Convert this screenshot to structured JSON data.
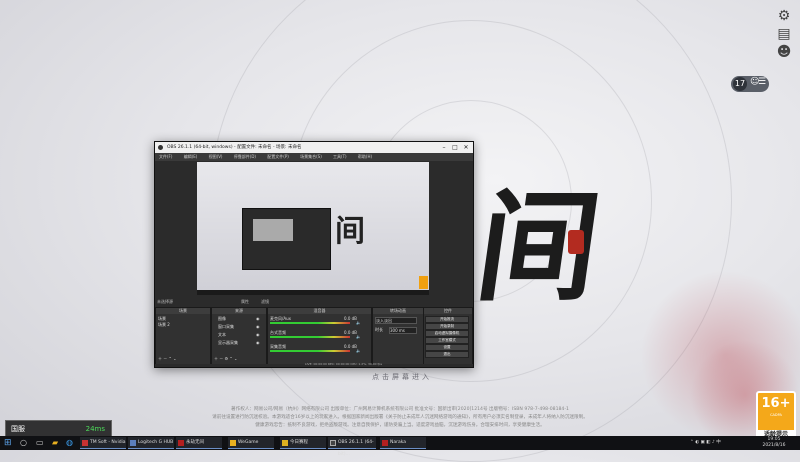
{
  "right_icons": [
    {
      "icon": "gear-icon"
    },
    {
      "icon": "announcement-icon"
    },
    {
      "icon": "account-icon"
    }
  ],
  "player_chip": {
    "number": "17"
  },
  "obs": {
    "title": "OBS 26.1.1 (64-bit, windows) - 配置文件: 未命名 - 场景: 未命名",
    "menu": [
      "文件(F)",
      "编辑(E)",
      "视图(V)",
      "停靠部件(D)",
      "配置文件(P)",
      "场景集合(S)",
      "工具(T)",
      "帮助(H)"
    ],
    "preview_label": "未选择源",
    "props_label": "属性",
    "filters_label": "滤镜",
    "docks": {
      "scenes": {
        "header": "场景",
        "items": [
          "场景",
          "场景 2"
        ]
      },
      "sources": {
        "header": "来源",
        "items": [
          "图像",
          "窗口采集",
          "文本",
          "显示器采集"
        ]
      },
      "mixer": {
        "header": "混音器",
        "items": [
          "麦克风/Aux",
          "台式音频",
          "采集音频"
        ],
        "levels": [
          "0.0 dB",
          "0.0 dB",
          "0.0 dB"
        ]
      },
      "transitions": {
        "header": "转场动画",
        "items": [
          "淡入淡出",
          "时长"
        ],
        "duration": "300 ms"
      },
      "controls": {
        "header": "控件",
        "buttons": [
          "开始推流",
          "开始录制",
          "启动虚拟摄像机",
          "工作室模式",
          "设置",
          "退出"
        ]
      }
    },
    "status": "LIVE: 00:00:00  REC: 00:00:00  CPU: 1.2%, 30.00 fps"
  },
  "enter_game": "点击屏幕进入",
  "footer_lines": [
    "著作权人：网易公司/网易（杭州）网络有限公司  出版单位：广州网易计算机系统有限公司  批准文号：国新出审[2020]1214号  出版物号：ISBN 978-7-498-08184-1",
    "请前往设置进行防沉迷校验。本游戏适合16岁以上的玩家进入。根据国家新闻出版署《关于防止未成年人沉迷网络游戏的通知》，所有用户必须实名制登录，未成年人将纳入防沉迷限制。",
    "健康游戏忠告：抵制不良游戏，拒绝盗版游戏。注意自我保护，谨防受骗上当。适度游戏益脑，沉迷游戏伤身。合理安排时间，享受健康生活。"
  ],
  "server": {
    "name": "国服",
    "latency": "24ms"
  },
  "age_rating": {
    "label": "16+",
    "small": "CADPA",
    "tip": "适龄提示"
  },
  "taskbar": {
    "apps": [
      {
        "label": "TM Soft - Nvidia",
        "color": "#c83232"
      },
      {
        "label": "Logitech G HUB",
        "color": "#5b7fbd"
      },
      {
        "label": "永劫无间",
        "color": "#b32020"
      },
      {
        "label": "WeGame",
        "color": "#e8b020"
      },
      {
        "label": "今日赛程",
        "color": "#ddb020"
      },
      {
        "label": "OBS 26.1.1 (64-bit)...",
        "color": "#444444"
      },
      {
        "label": "Naraka",
        "color": "#b32020"
      }
    ],
    "time": "19:05",
    "date": "2021/8/16"
  },
  "colors": {
    "accent_green": "#4ddc5a",
    "age_orange": "#f4a81a",
    "seal_red": "#b32b20"
  }
}
